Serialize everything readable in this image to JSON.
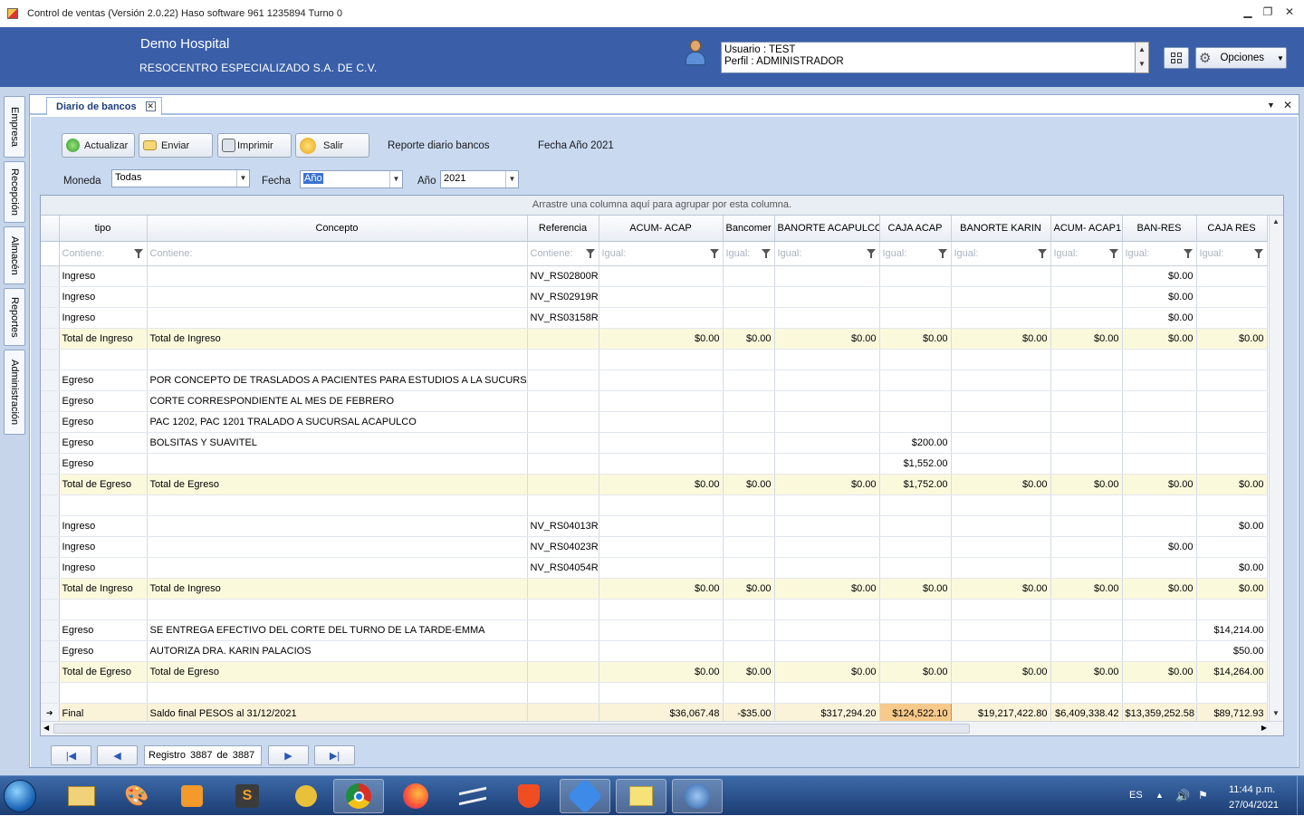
{
  "window": {
    "title": "Control de ventas  (Versión 2.0.22)  Haso software  961 1235894  Turno 0",
    "minimize": "▁",
    "restore": "❐",
    "close": "✕"
  },
  "header": {
    "company": "Demo Hospital",
    "subtitle": "RESOCENTRO ESPECIALIZADO S.A. DE C.V.",
    "user_line": "Usuario : TEST",
    "profile_line": "Perfil : ADMINISTRADOR",
    "options_label": "Opciones"
  },
  "sidebar": {
    "items": [
      {
        "label": "Empresa"
      },
      {
        "label": "Recepción"
      },
      {
        "label": "Almacén"
      },
      {
        "label": "Reportes"
      },
      {
        "label": "Administración"
      }
    ]
  },
  "document": {
    "tab_label": "Diario de bancos",
    "tab_close": "✕"
  },
  "toolbar": {
    "refresh": "Actualizar",
    "send": "Enviar",
    "print": "Imprimir",
    "exit": "Salir",
    "report_title": "Reporte diario bancos",
    "report_date": "Fecha Año 2021"
  },
  "filters": {
    "currency_label": "Moneda",
    "currency_value": "Todas",
    "date_label": "Fecha",
    "date_value": "Año",
    "year_label": "Año",
    "year_value": "2021"
  },
  "grid": {
    "group_hint": "Arrastre una columna aquí para agrupar por esta columna.",
    "columns": [
      "tipo",
      "Concepto",
      "Referencia",
      "ACUM- ACAP",
      "Bancomer",
      "BANORTE ACAPULCO",
      "CAJA ACAP",
      "BANORTE KARIN",
      "ACUM- ACAP1",
      "BAN-RES",
      "CAJA RES"
    ],
    "filter_placeholders": [
      "Contiene:",
      "Contiene:",
      "Contiene:",
      "Igual:",
      "Igual:",
      "Igual:",
      "Igual:",
      "Igual:",
      "Igual:",
      "Igual:",
      "Igual:"
    ],
    "rows": [
      {
        "kind": "data",
        "cells": [
          "Ingreso",
          "",
          "NV_RS02800R",
          "",
          "",
          "",
          "",
          "",
          "",
          "$0.00",
          ""
        ]
      },
      {
        "kind": "data",
        "cells": [
          "Ingreso",
          "",
          "NV_RS02919R",
          "",
          "",
          "",
          "",
          "",
          "",
          "$0.00",
          ""
        ]
      },
      {
        "kind": "data",
        "cells": [
          "Ingreso",
          "",
          "NV_RS03158R",
          "",
          "",
          "",
          "",
          "",
          "",
          "$0.00",
          ""
        ]
      },
      {
        "kind": "total",
        "cells": [
          "Total de Ingreso",
          "Total de Ingreso",
          "",
          "$0.00",
          "$0.00",
          "$0.00",
          "$0.00",
          "$0.00",
          "$0.00",
          "$0.00",
          "$0.00"
        ]
      },
      {
        "kind": "blank",
        "cells": [
          "",
          "",
          "",
          "",
          "",
          "",
          "",
          "",
          "",
          "",
          ""
        ]
      },
      {
        "kind": "data",
        "cells": [
          "Egreso",
          "POR CONCEPTO DE TRASLADOS A PACIENTES PARA ESTUDIOS A LA SUCURSALES",
          "",
          "",
          "",
          "",
          "",
          "",
          "",
          "",
          ""
        ]
      },
      {
        "kind": "data",
        "cells": [
          "Egreso",
          "CORTE CORRESPONDIENTE AL MES DE FEBRERO",
          "",
          "",
          "",
          "",
          "",
          "",
          "",
          "",
          ""
        ]
      },
      {
        "kind": "data",
        "cells": [
          "Egreso",
          "PAC 1202, PAC 1201 TRALADO A SUCURSAL ACAPULCO",
          "",
          "",
          "",
          "",
          "",
          "",
          "",
          "",
          ""
        ]
      },
      {
        "kind": "data",
        "cells": [
          "Egreso",
          "BOLSITAS Y SUAVITEL",
          "",
          "",
          "",
          "",
          "$200.00",
          "",
          "",
          "",
          ""
        ]
      },
      {
        "kind": "data",
        "cells": [
          "Egreso",
          "",
          "",
          "",
          "",
          "",
          "$1,552.00",
          "",
          "",
          "",
          ""
        ]
      },
      {
        "kind": "total",
        "cells": [
          "Total de Egreso",
          "Total de Egreso",
          "",
          "$0.00",
          "$0.00",
          "$0.00",
          "$1,752.00",
          "$0.00",
          "$0.00",
          "$0.00",
          "$0.00"
        ]
      },
      {
        "kind": "blank",
        "cells": [
          "",
          "",
          "",
          "",
          "",
          "",
          "",
          "",
          "",
          "",
          ""
        ]
      },
      {
        "kind": "data",
        "cells": [
          "Ingreso",
          "",
          "NV_RS04013R",
          "",
          "",
          "",
          "",
          "",
          "",
          "",
          "$0.00"
        ]
      },
      {
        "kind": "data",
        "cells": [
          "Ingreso",
          "",
          "NV_RS04023R",
          "",
          "",
          "",
          "",
          "",
          "",
          "$0.00",
          ""
        ]
      },
      {
        "kind": "data",
        "cells": [
          "Ingreso",
          "",
          "NV_RS04054R",
          "",
          "",
          "",
          "",
          "",
          "",
          "",
          "$0.00"
        ]
      },
      {
        "kind": "total",
        "cells": [
          "Total de Ingreso",
          "Total de Ingreso",
          "",
          "$0.00",
          "$0.00",
          "$0.00",
          "$0.00",
          "$0.00",
          "$0.00",
          "$0.00",
          "$0.00"
        ]
      },
      {
        "kind": "blank",
        "cells": [
          "",
          "",
          "",
          "",
          "",
          "",
          "",
          "",
          "",
          "",
          ""
        ]
      },
      {
        "kind": "data",
        "cells": [
          "Egreso",
          "SE ENTREGA EFECTIVO DEL CORTE DEL TURNO DE LA TARDE-EMMA",
          "",
          "",
          "",
          "",
          "",
          "",
          "",
          "",
          "$14,214.00"
        ]
      },
      {
        "kind": "data",
        "cells": [
          "Egreso",
          "AUTORIZA DRA. KARIN PALACIOS",
          "",
          "",
          "",
          "",
          "",
          "",
          "",
          "",
          "$50.00"
        ]
      },
      {
        "kind": "total",
        "cells": [
          "Total de Egreso",
          "Total de Egreso",
          "",
          "$0.00",
          "$0.00",
          "$0.00",
          "$0.00",
          "$0.00",
          "$0.00",
          "$0.00",
          "$14,264.00"
        ]
      },
      {
        "kind": "blank",
        "cells": [
          "",
          "",
          "",
          "",
          "",
          "",
          "",
          "",
          "",
          "",
          ""
        ]
      }
    ],
    "final_row": {
      "indicator": "➔",
      "cells": [
        "Final",
        "Saldo final PESOS al 31/12/2021",
        "",
        "$36,067.48",
        "-$35.00",
        "$317,294.20",
        "$124,522.10",
        "$19,217,422.80",
        "$6,409,338.42",
        "$13,359,252.58",
        "$89,712.93"
      ]
    }
  },
  "navigator": {
    "record_label": "Registro",
    "current": "3887",
    "of_label": "de",
    "total": "3887"
  },
  "taskbar": {
    "language": "ES",
    "time": "11:44 p.m.",
    "date": "27/04/2021"
  }
}
